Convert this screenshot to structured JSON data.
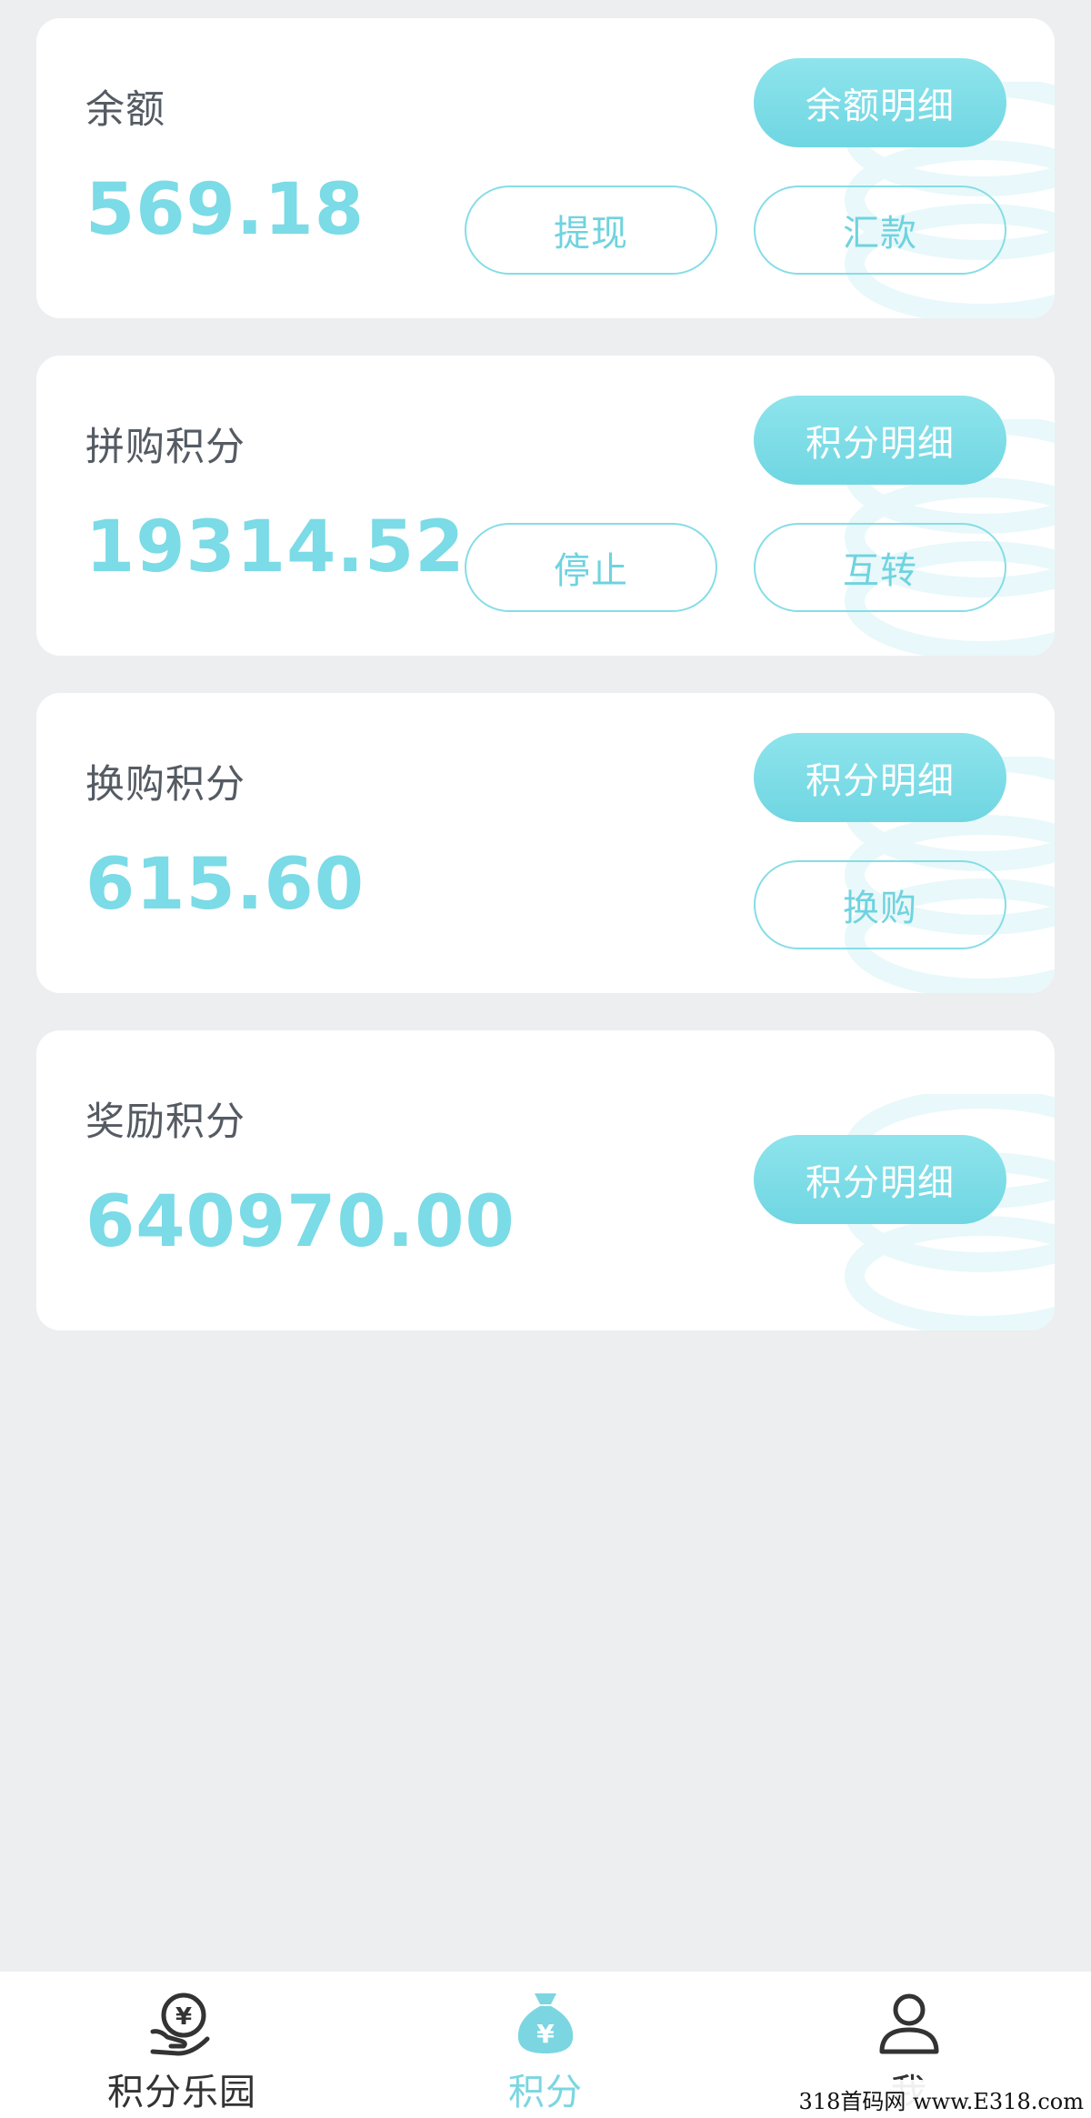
{
  "cards": [
    {
      "label": "余额",
      "amount": "569.18",
      "detail_button": "余额明细",
      "actions": [
        "提现",
        "汇款"
      ]
    },
    {
      "label": "拼购积分",
      "amount": "19314.52",
      "detail_button": "积分明细",
      "actions": [
        "停止",
        "互转"
      ]
    },
    {
      "label": "换购积分",
      "amount": "615.60",
      "detail_button": "积分明细",
      "actions": [
        "换购"
      ]
    },
    {
      "label": "奖励积分",
      "amount": "640970.00",
      "detail_button": "积分明细",
      "actions": []
    }
  ],
  "tabbar": {
    "items": [
      {
        "label": "积分乐园",
        "icon": "hand-coin-icon",
        "active": false
      },
      {
        "label": "积分",
        "icon": "money-bag-icon",
        "active": true
      },
      {
        "label": "我",
        "icon": "user-icon",
        "active": false
      }
    ]
  },
  "watermark": "318首码网 www.E318.com",
  "colors": {
    "accent": "#7bdbe6",
    "label": "#555b63",
    "background": "#edeef0"
  }
}
